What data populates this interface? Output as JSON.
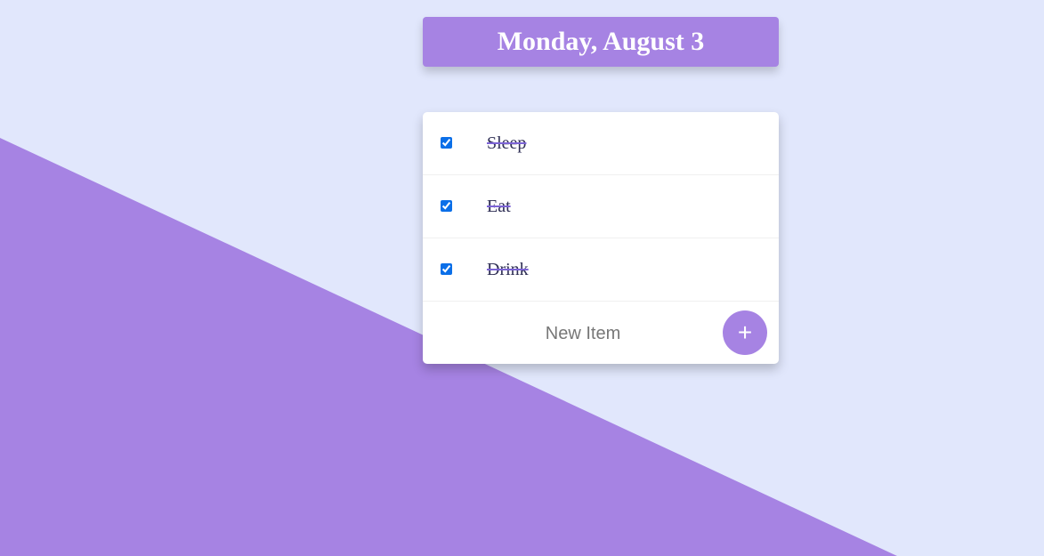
{
  "heading": {
    "date": "Monday, August 3"
  },
  "todo": {
    "items": [
      {
        "label": "Sleep",
        "checked": true
      },
      {
        "label": "Eat",
        "checked": true
      },
      {
        "label": "Drink",
        "checked": true
      }
    ],
    "new_item": {
      "placeholder": "New Item",
      "value": ""
    },
    "add_button_label": "+"
  },
  "colors": {
    "background": "#e1e7fc",
    "accent": "#a683e3",
    "checkbox": "#0b6fe8"
  },
  "icons": {
    "add": "plus-icon"
  }
}
